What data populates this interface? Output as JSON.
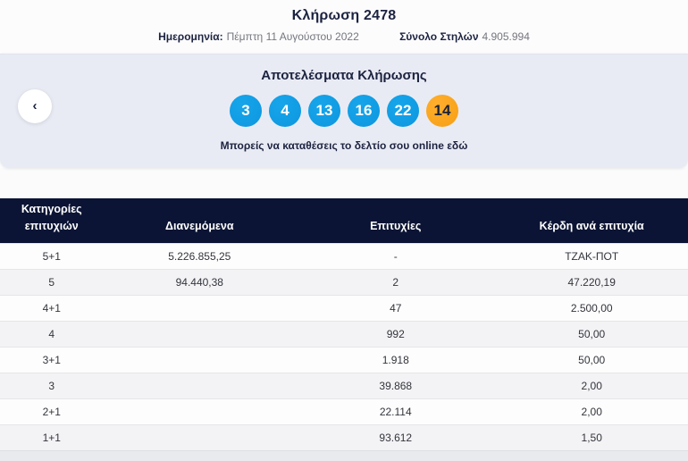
{
  "header": {
    "title": "Κλήρωση 2478",
    "date_label": "Ημερομηνία:",
    "date_value": "Πέμπτη 11 Αυγούστου 2022",
    "columns_label": "Σύνολο Στηλών",
    "columns_value": "4.905.994"
  },
  "results": {
    "heading": "Αποτελέσματα Κλήρωσης",
    "numbers": [
      "3",
      "4",
      "13",
      "16",
      "22"
    ],
    "joker_number": "14",
    "footer_text": "Μπορείς να καταθέσεις το δελτίο σου online",
    "footer_link": "εδώ",
    "prev_icon": "chevron-left-icon",
    "prev_glyph": "‹"
  },
  "colors": {
    "ball_blue": "#0d97df",
    "ball_orange": "#f79f12",
    "header_navy": "#0b1434",
    "band_lavender": "#e9ebf4"
  },
  "table": {
    "headers": [
      "Κατηγορίες επιτυχιών",
      "Διανεμόμενα",
      "Επιτυχίες",
      "Κέρδη ανά επιτυχία"
    ],
    "rows": [
      {
        "category": "5+1",
        "distributed": "5.226.855,25",
        "winners": "-",
        "prize": "ΤΖΑΚ-ΠΟΤ"
      },
      {
        "category": "5",
        "distributed": "94.440,38",
        "winners": "2",
        "prize": "47.220,19"
      },
      {
        "category": "4+1",
        "distributed": "",
        "winners": "47",
        "prize": "2.500,00"
      },
      {
        "category": "4",
        "distributed": "",
        "winners": "992",
        "prize": "50,00"
      },
      {
        "category": "3+1",
        "distributed": "",
        "winners": "1.918",
        "prize": "50,00"
      },
      {
        "category": "3",
        "distributed": "",
        "winners": "39.868",
        "prize": "2,00"
      },
      {
        "category": "2+1",
        "distributed": "",
        "winners": "22.114",
        "prize": "2,00"
      },
      {
        "category": "1+1",
        "distributed": "",
        "winners": "93.612",
        "prize": "1,50"
      }
    ]
  }
}
